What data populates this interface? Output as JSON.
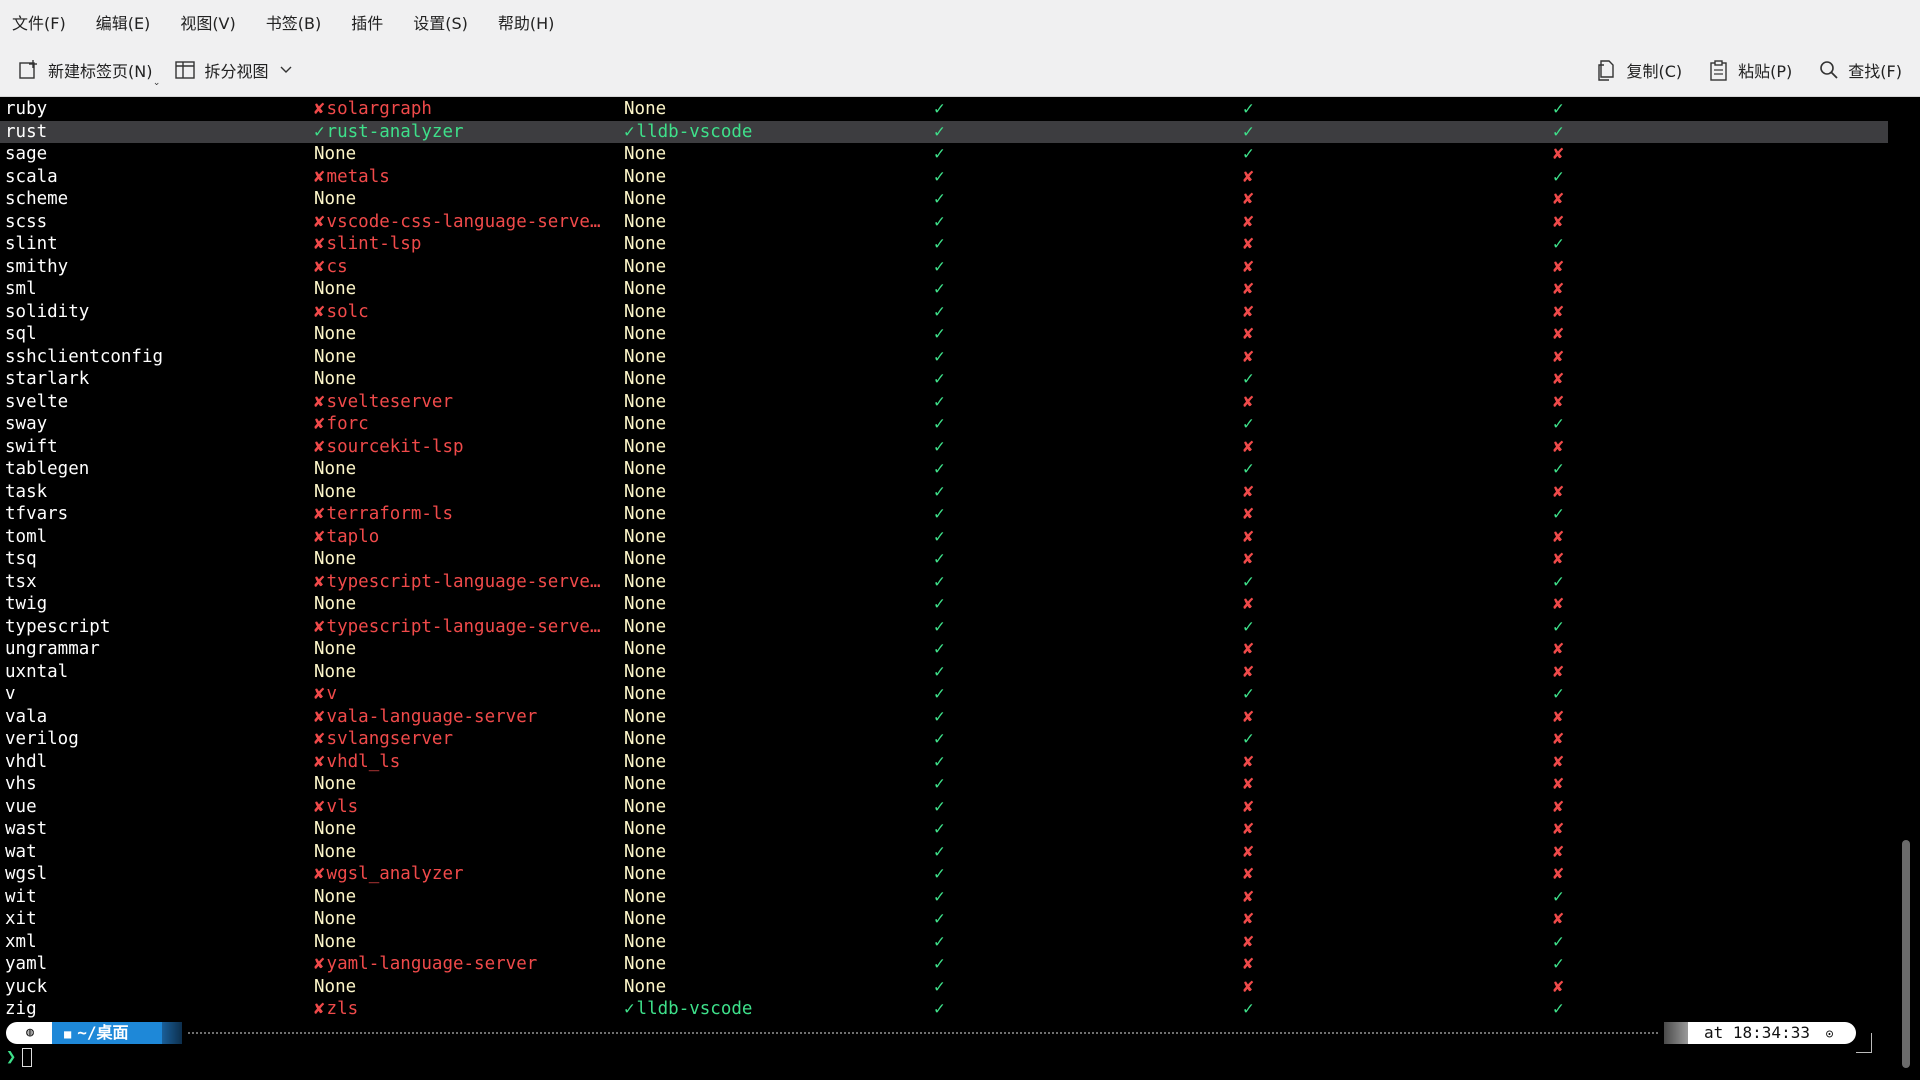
{
  "menu": [
    "文件(F)",
    "编辑(E)",
    "视图(V)",
    "书签(B)",
    "插件",
    "设置(S)",
    "帮助(H)"
  ],
  "toolbar": {
    "new_tab": "新建标签页(N)",
    "split_view": "拆分视图",
    "copy": "复制(C)",
    "paste": "粘贴(P)",
    "find": "查找(F)"
  },
  "glyphs": {
    "check": "✓",
    "cross": "✘"
  },
  "rows": [
    {
      "name": "ruby",
      "lsp": "solargraph",
      "lsp_ok": false,
      "dap": "None",
      "dap_ok": null,
      "hl": true,
      "ts": true,
      "ind": true
    },
    {
      "name": "rust",
      "lsp": "rust-analyzer",
      "lsp_ok": true,
      "dap": "lldb-vscode",
      "dap_ok": true,
      "hl": true,
      "ts": true,
      "ind": true,
      "selected": true
    },
    {
      "name": "sage",
      "lsp": "None",
      "lsp_ok": null,
      "dap": "None",
      "dap_ok": null,
      "hl": true,
      "ts": true,
      "ind": false
    },
    {
      "name": "scala",
      "lsp": "metals",
      "lsp_ok": false,
      "dap": "None",
      "dap_ok": null,
      "hl": true,
      "ts": false,
      "ind": true
    },
    {
      "name": "scheme",
      "lsp": "None",
      "lsp_ok": null,
      "dap": "None",
      "dap_ok": null,
      "hl": true,
      "ts": false,
      "ind": false
    },
    {
      "name": "scss",
      "lsp": "vscode-css-language-serve…",
      "lsp_ok": false,
      "dap": "None",
      "dap_ok": null,
      "hl": true,
      "ts": false,
      "ind": false
    },
    {
      "name": "slint",
      "lsp": "slint-lsp",
      "lsp_ok": false,
      "dap": "None",
      "dap_ok": null,
      "hl": true,
      "ts": false,
      "ind": true
    },
    {
      "name": "smithy",
      "lsp": "cs",
      "lsp_ok": false,
      "dap": "None",
      "dap_ok": null,
      "hl": true,
      "ts": false,
      "ind": false
    },
    {
      "name": "sml",
      "lsp": "None",
      "lsp_ok": null,
      "dap": "None",
      "dap_ok": null,
      "hl": true,
      "ts": false,
      "ind": false
    },
    {
      "name": "solidity",
      "lsp": "solc",
      "lsp_ok": false,
      "dap": "None",
      "dap_ok": null,
      "hl": true,
      "ts": false,
      "ind": false
    },
    {
      "name": "sql",
      "lsp": "None",
      "lsp_ok": null,
      "dap": "None",
      "dap_ok": null,
      "hl": true,
      "ts": false,
      "ind": false
    },
    {
      "name": "sshclientconfig",
      "lsp": "None",
      "lsp_ok": null,
      "dap": "None",
      "dap_ok": null,
      "hl": true,
      "ts": false,
      "ind": false
    },
    {
      "name": "starlark",
      "lsp": "None",
      "lsp_ok": null,
      "dap": "None",
      "dap_ok": null,
      "hl": true,
      "ts": true,
      "ind": false
    },
    {
      "name": "svelte",
      "lsp": "svelteserver",
      "lsp_ok": false,
      "dap": "None",
      "dap_ok": null,
      "hl": true,
      "ts": false,
      "ind": false
    },
    {
      "name": "sway",
      "lsp": "forc",
      "lsp_ok": false,
      "dap": "None",
      "dap_ok": null,
      "hl": true,
      "ts": true,
      "ind": true
    },
    {
      "name": "swift",
      "lsp": "sourcekit-lsp",
      "lsp_ok": false,
      "dap": "None",
      "dap_ok": null,
      "hl": true,
      "ts": false,
      "ind": false
    },
    {
      "name": "tablegen",
      "lsp": "None",
      "lsp_ok": null,
      "dap": "None",
      "dap_ok": null,
      "hl": true,
      "ts": true,
      "ind": true
    },
    {
      "name": "task",
      "lsp": "None",
      "lsp_ok": null,
      "dap": "None",
      "dap_ok": null,
      "hl": true,
      "ts": false,
      "ind": false
    },
    {
      "name": "tfvars",
      "lsp": "terraform-ls",
      "lsp_ok": false,
      "dap": "None",
      "dap_ok": null,
      "hl": true,
      "ts": false,
      "ind": true
    },
    {
      "name": "toml",
      "lsp": "taplo",
      "lsp_ok": false,
      "dap": "None",
      "dap_ok": null,
      "hl": true,
      "ts": false,
      "ind": false
    },
    {
      "name": "tsq",
      "lsp": "None",
      "lsp_ok": null,
      "dap": "None",
      "dap_ok": null,
      "hl": true,
      "ts": false,
      "ind": false
    },
    {
      "name": "tsx",
      "lsp": "typescript-language-serve…",
      "lsp_ok": false,
      "dap": "None",
      "dap_ok": null,
      "hl": true,
      "ts": true,
      "ind": true
    },
    {
      "name": "twig",
      "lsp": "None",
      "lsp_ok": null,
      "dap": "None",
      "dap_ok": null,
      "hl": true,
      "ts": false,
      "ind": false
    },
    {
      "name": "typescript",
      "lsp": "typescript-language-serve…",
      "lsp_ok": false,
      "dap": "None",
      "dap_ok": null,
      "hl": true,
      "ts": true,
      "ind": true
    },
    {
      "name": "ungrammar",
      "lsp": "None",
      "lsp_ok": null,
      "dap": "None",
      "dap_ok": null,
      "hl": true,
      "ts": false,
      "ind": false
    },
    {
      "name": "uxntal",
      "lsp": "None",
      "lsp_ok": null,
      "dap": "None",
      "dap_ok": null,
      "hl": true,
      "ts": false,
      "ind": false
    },
    {
      "name": "v",
      "lsp": "v",
      "lsp_ok": false,
      "dap": "None",
      "dap_ok": null,
      "hl": true,
      "ts": true,
      "ind": true
    },
    {
      "name": "vala",
      "lsp": "vala-language-server",
      "lsp_ok": false,
      "dap": "None",
      "dap_ok": null,
      "hl": true,
      "ts": false,
      "ind": false
    },
    {
      "name": "verilog",
      "lsp": "svlangserver",
      "lsp_ok": false,
      "dap": "None",
      "dap_ok": null,
      "hl": true,
      "ts": true,
      "ind": false
    },
    {
      "name": "vhdl",
      "lsp": "vhdl_ls",
      "lsp_ok": false,
      "dap": "None",
      "dap_ok": null,
      "hl": true,
      "ts": false,
      "ind": false
    },
    {
      "name": "vhs",
      "lsp": "None",
      "lsp_ok": null,
      "dap": "None",
      "dap_ok": null,
      "hl": true,
      "ts": false,
      "ind": false
    },
    {
      "name": "vue",
      "lsp": "vls",
      "lsp_ok": false,
      "dap": "None",
      "dap_ok": null,
      "hl": true,
      "ts": false,
      "ind": false
    },
    {
      "name": "wast",
      "lsp": "None",
      "lsp_ok": null,
      "dap": "None",
      "dap_ok": null,
      "hl": true,
      "ts": false,
      "ind": false
    },
    {
      "name": "wat",
      "lsp": "None",
      "lsp_ok": null,
      "dap": "None",
      "dap_ok": null,
      "hl": true,
      "ts": false,
      "ind": false
    },
    {
      "name": "wgsl",
      "lsp": "wgsl_analyzer",
      "lsp_ok": false,
      "dap": "None",
      "dap_ok": null,
      "hl": true,
      "ts": false,
      "ind": false
    },
    {
      "name": "wit",
      "lsp": "None",
      "lsp_ok": null,
      "dap": "None",
      "dap_ok": null,
      "hl": true,
      "ts": false,
      "ind": true
    },
    {
      "name": "xit",
      "lsp": "None",
      "lsp_ok": null,
      "dap": "None",
      "dap_ok": null,
      "hl": true,
      "ts": false,
      "ind": false
    },
    {
      "name": "xml",
      "lsp": "None",
      "lsp_ok": null,
      "dap": "None",
      "dap_ok": null,
      "hl": true,
      "ts": false,
      "ind": true
    },
    {
      "name": "yaml",
      "lsp": "yaml-language-server",
      "lsp_ok": false,
      "dap": "None",
      "dap_ok": null,
      "hl": true,
      "ts": false,
      "ind": true
    },
    {
      "name": "yuck",
      "lsp": "None",
      "lsp_ok": null,
      "dap": "None",
      "dap_ok": null,
      "hl": true,
      "ts": false,
      "ind": false
    },
    {
      "name": "zig",
      "lsp": "zls",
      "lsp_ok": false,
      "dap": "lldb-vscode",
      "dap_ok": true,
      "hl": true,
      "ts": true,
      "ind": true
    }
  ],
  "prompt": {
    "dir": "~/桌面",
    "time": "at 18:34:33",
    "clock_icon": "clock-icon",
    "char": "❯"
  },
  "colors": {
    "none": "#fdf6c9",
    "bad": "#f04a4a",
    "good": "#3ee08a",
    "dir_bg": "#1e88d8"
  }
}
